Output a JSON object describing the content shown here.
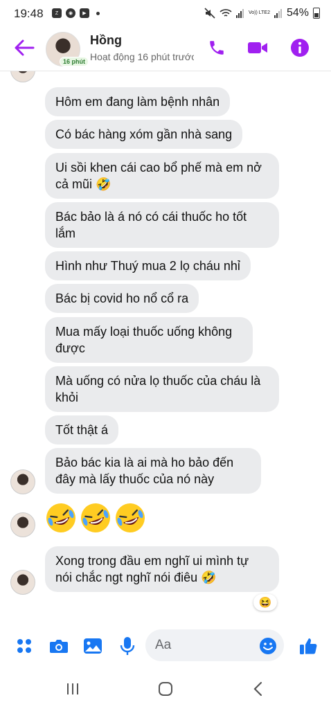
{
  "status_bar": {
    "time": "19:48",
    "app_icons": [
      "zalo-icon",
      "chrome-icon",
      "youtube-icon"
    ],
    "network_label": "Vo)) LTE2",
    "battery_percent": "54%"
  },
  "header": {
    "contact_name": "Hồng",
    "active_badge": "16 phút",
    "status": "Hoạt động 16 phút trước",
    "accent_color": "#a020f0",
    "icons": [
      "back-arrow-icon",
      "phone-icon",
      "video-call-icon",
      "info-icon"
    ]
  },
  "messages": [
    {
      "text": "Hôm em đang làm bệnh nhân"
    },
    {
      "text": "Có bác hàng xóm gần nhà sang"
    },
    {
      "text": "Ui sồi khen cái cao bổ phế mà em nở cả mũi 🤣"
    },
    {
      "text": "Bác bảo là á nó có cái thuốc ho tốt lắm"
    },
    {
      "text": "Hình như Thuý mua 2 lọ cháu nhỉ"
    },
    {
      "text": "Bác bị covid ho nổ cổ ra"
    },
    {
      "text": "Mua mấy loại thuốc uống không được"
    },
    {
      "text": "Mà uống có nửa lọ thuốc của cháu là khỏi"
    },
    {
      "text": "Tốt thật á"
    },
    {
      "text": "Bảo bác kia là ai mà ho bảo đến đây mà lấy thuốc của nó này"
    },
    {
      "emoji": "🤣🤣🤣"
    },
    {
      "text": "Xong trong đầu em nghĩ ui mình tự nói chắc ngt nghĩ nói điêu 🤣",
      "reaction": "😆"
    }
  ],
  "composer": {
    "placeholder": "Aa",
    "icons": [
      "apps-icon",
      "camera-icon",
      "gallery-icon",
      "microphone-icon",
      "emoji-icon",
      "thumbs-up-icon"
    ],
    "accent_color": "#1877f2"
  },
  "nav_bar": {
    "icons": [
      "recent-apps-icon",
      "home-icon",
      "back-icon"
    ]
  }
}
